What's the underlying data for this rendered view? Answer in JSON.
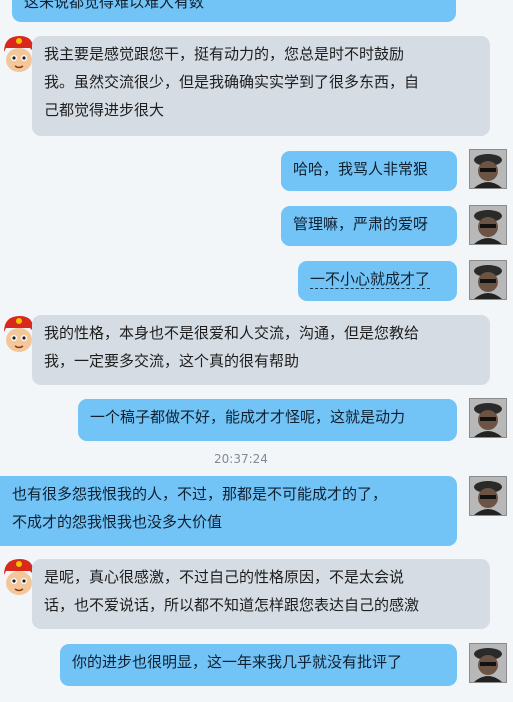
{
  "chat": {
    "messages": [
      {
        "side": "out",
        "lines": [
          "这未说都觉得难以难大有数"
        ]
      },
      {
        "side": "in",
        "lines": [
          "我主要是感觉跟您干，挺有动力的，您总是时不时鼓励",
          "我。虽然交流很少，但是我确确实实学到了很多东西，自",
          "己都觉得进步很大"
        ]
      },
      {
        "side": "out",
        "lines": [
          "哈哈，我骂人非常狠"
        ]
      },
      {
        "side": "out",
        "lines": [
          "管理嘛，严肃的爱呀"
        ]
      },
      {
        "side": "out",
        "lines": [
          "一不小心就成才了"
        ]
      },
      {
        "side": "in",
        "lines": [
          "我的性格，本身也不是很爱和人交流，沟通，但是您教给",
          "我，一定要多交流，这个真的很有帮助"
        ]
      },
      {
        "side": "out",
        "lines": [
          "一个稿子都做不好，能成才才怪呢，这就是动力"
        ]
      },
      {
        "side": "out",
        "lines": [
          "也有很多怨我恨我的人，不过，那都是不可能成才的了，",
          "不成才的怨我恨我也没多大价值"
        ]
      },
      {
        "side": "in",
        "lines": [
          "是呢，真心很感激，不过自己的性格原因，不是太会说",
          "话，也不爱说话，所以都不知道怎样跟您表达自己的感激"
        ]
      },
      {
        "side": "out",
        "lines": [
          "你的进步也很明显，这一年来我几乎就没有批评了"
        ]
      }
    ],
    "timestamp": "20:37:24"
  }
}
